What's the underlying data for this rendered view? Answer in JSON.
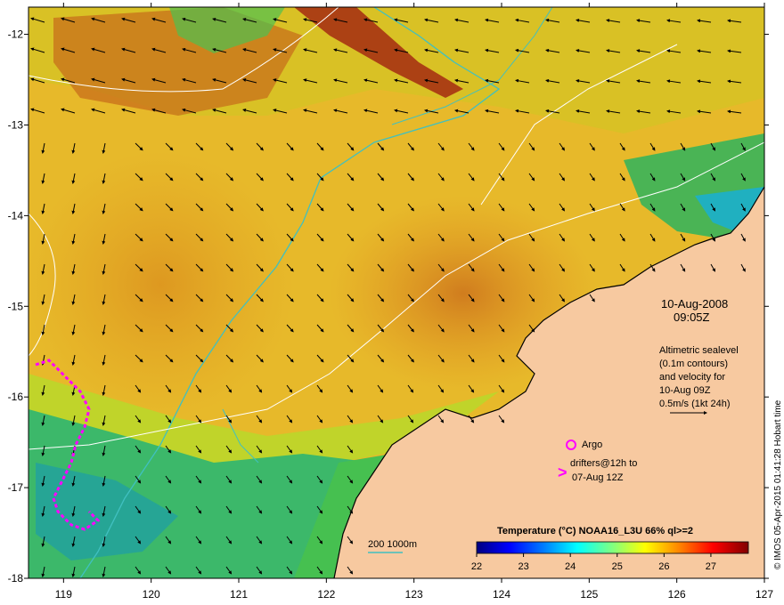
{
  "map": {
    "x_ticks": [
      "119",
      "120",
      "121",
      "122",
      "123",
      "124",
      "125",
      "126",
      "127"
    ],
    "y_ticks": [
      "-12",
      "-13",
      "-14",
      "-15",
      "-16",
      "-17",
      "-18"
    ],
    "lon_range": [
      118.6,
      127.0
    ],
    "lat_range": [
      -18.0,
      -11.7
    ],
    "land_color": "#f7c9a0",
    "isobath_color": "#40c0c0",
    "contour_color": "#ffffff"
  },
  "annotations": {
    "date": "10-Aug-2008",
    "time": "09:05Z",
    "altimetry_lines": [
      "Altimetric sealevel",
      "(0.1m contours)",
      "and velocity for",
      "10-Aug 09Z",
      "0.5m/s (1kt 24h)"
    ],
    "argo_label": "Argo",
    "drifters_lines": [
      "drifters@12h to",
      "07-Aug 12Z"
    ],
    "isobath_label": "200  1000m",
    "vertical_credit": "© IMOS 05-Apr-2015 01:41:28 Hobart time"
  },
  "colorbar": {
    "title": "Temperature (°C) NOAA16_L3U 66% ql>=2",
    "ticks": [
      "22",
      "23",
      "24",
      "25",
      "26",
      "27"
    ],
    "range": [
      22,
      27.8
    ],
    "colors": [
      "#000080",
      "#0000ff",
      "#0080ff",
      "#00ffff",
      "#80ff80",
      "#ffff00",
      "#ff8000",
      "#ff0000",
      "#800000"
    ]
  },
  "legend_markers": {
    "argo_color": "#ff00ff",
    "drifter_color": "#ff00ff"
  }
}
